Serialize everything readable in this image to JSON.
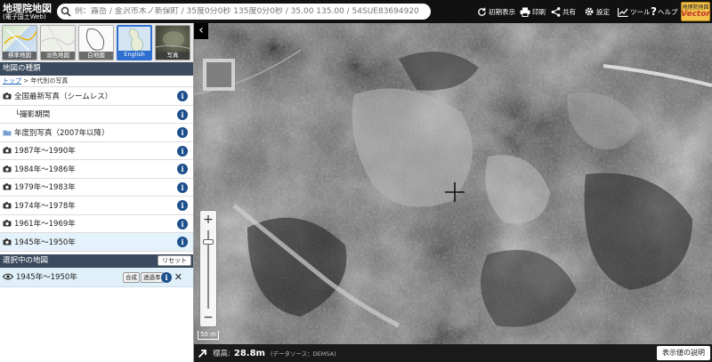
{
  "header": {
    "logo_line1": "地理院地図",
    "logo_line2": "(電子国土Web)",
    "search_placeholder": "例：霧岳 / 金沢市木ノ新保町 / 35度0分0秒 135度0分0秒 / 35.00 135.00 / 54SUE83694920",
    "buttons": {
      "initial_view": "初期表示",
      "print": "印刷",
      "share": "共有",
      "settings": "設定",
      "tools": "ツール",
      "help": "ヘルプ"
    },
    "vector_badge": {
      "line1": "地理院地図",
      "line2": "Vector"
    }
  },
  "sidebar": {
    "thumbnails": [
      {
        "label": "標準地図",
        "selected": false
      },
      {
        "label": "淡色地図",
        "selected": false
      },
      {
        "label": "白地図",
        "selected": false
      },
      {
        "label": "English",
        "selected": true
      },
      {
        "label": "写真",
        "selected": false
      }
    ],
    "map_types_title": "地図の種類",
    "breadcrumb": {
      "top": "トップ",
      "sep": " > ",
      "current": "年代別の写真"
    },
    "items": [
      {
        "label": "全国最新写真（シームレス）",
        "icon": "camera-icon",
        "active": false
      },
      {
        "label": "└撮影期間",
        "icon": "",
        "active": false
      },
      {
        "label": "年度別写真（2007年以降）",
        "icon": "folder-icon",
        "active": false
      },
      {
        "label": "1987年〜1990年",
        "icon": "camera-icon",
        "active": false
      },
      {
        "label": "1984年〜1986年",
        "icon": "camera-icon",
        "active": false
      },
      {
        "label": "1979年〜1983年",
        "icon": "camera-icon",
        "active": false
      },
      {
        "label": "1974年〜1978年",
        "icon": "camera-icon",
        "active": false
      },
      {
        "label": "1961年〜1969年",
        "icon": "camera-icon",
        "active": false
      },
      {
        "label": "1945年〜1950年",
        "icon": "camera-icon",
        "active": true
      }
    ],
    "info_label": "i",
    "selected_title": "選択中の地図",
    "reset_label": "リセット",
    "selected_item": {
      "label": "1945年〜1950年",
      "composite_label": "合成",
      "opacity_label": "透過率",
      "remove_label": "✕"
    }
  },
  "map": {
    "zoom_in": "+",
    "zoom_out": "−",
    "zoom_level": 0.85,
    "scale_label": "50 m",
    "collapse_label": "‹"
  },
  "bottom_bar": {
    "elevation_label": "標高:",
    "elevation_value": "28.8m",
    "source": "(データソース：DEM5A)",
    "explain_button": "表示値の説明"
  }
}
